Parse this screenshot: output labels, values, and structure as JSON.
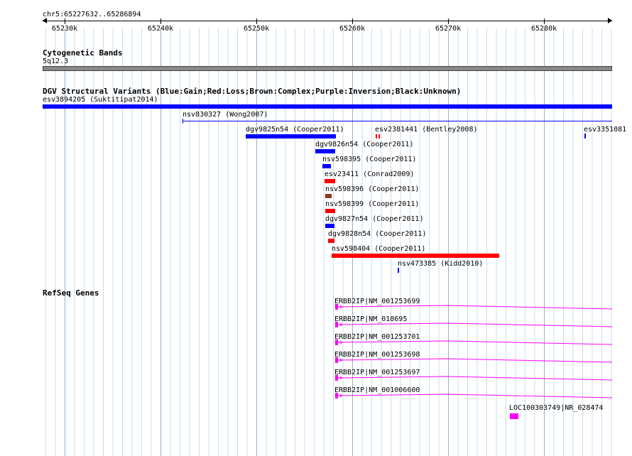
{
  "location": "chr5:65227632..65286894",
  "ruler": {
    "ticks": [
      "65230k",
      "65240k",
      "65250k",
      "65260k",
      "65270k",
      "65280k"
    ]
  },
  "cytobands": {
    "title": "Cytogenetic Bands",
    "band": "5q12.3"
  },
  "dgv": {
    "title": "DGV Structural Variants (Blue:Gain;Red:Loss;Brown:Complex;Purple:Inversion;Black:Unknown)",
    "colors": {
      "gain": "#0000ff",
      "loss": "#ff0000",
      "complex": "#8b3a1a",
      "inversion": "#800080",
      "unknown": "#000000"
    },
    "features": [
      {
        "label": "esv3894205 (Suktitipat2014)",
        "type": "gain"
      },
      {
        "label": "nsv830327 (Wong2007)",
        "type": "gain"
      },
      {
        "label": "dgv9825n54 (Cooper2011)",
        "type": "gain"
      },
      {
        "label": "esv2381441 (Bentley2008)",
        "type": "loss"
      },
      {
        "label": "esv3351081",
        "type": "gain"
      },
      {
        "label": "dgv9826n54 (Cooper2011)",
        "type": "gain"
      },
      {
        "label": "nsv598395 (Cooper2011)",
        "type": "gain"
      },
      {
        "label": "esv23411 (Conrad2009)",
        "type": "loss"
      },
      {
        "label": "nsv598396 (Cooper2011)",
        "type": "complex"
      },
      {
        "label": "nsv598399 (Cooper2011)",
        "type": "loss"
      },
      {
        "label": "dgv9827n54 (Cooper2011)",
        "type": "gain"
      },
      {
        "label": "dgv9828n54 (Cooper2011)",
        "type": "loss"
      },
      {
        "label": "nsv598404 (Cooper2011)",
        "type": "loss"
      },
      {
        "label": "nsv473385 (Kidd2010)",
        "type": "gain"
      }
    ]
  },
  "refseq": {
    "title": "RefSeq Genes",
    "genes": [
      {
        "label": "ERBB2IP|NM_001253699"
      },
      {
        "label": "ERBB2IP|NM_018695"
      },
      {
        "label": "ERBB2IP|NM_001253701"
      },
      {
        "label": "ERBB2IP|NM_001253698"
      },
      {
        "label": "ERBB2IP|NM_001253697"
      },
      {
        "label": "ERBB2IP|NM_001006600"
      },
      {
        "label": "LOC100303749|NR_028474"
      }
    ],
    "color": "#ff00ff"
  }
}
